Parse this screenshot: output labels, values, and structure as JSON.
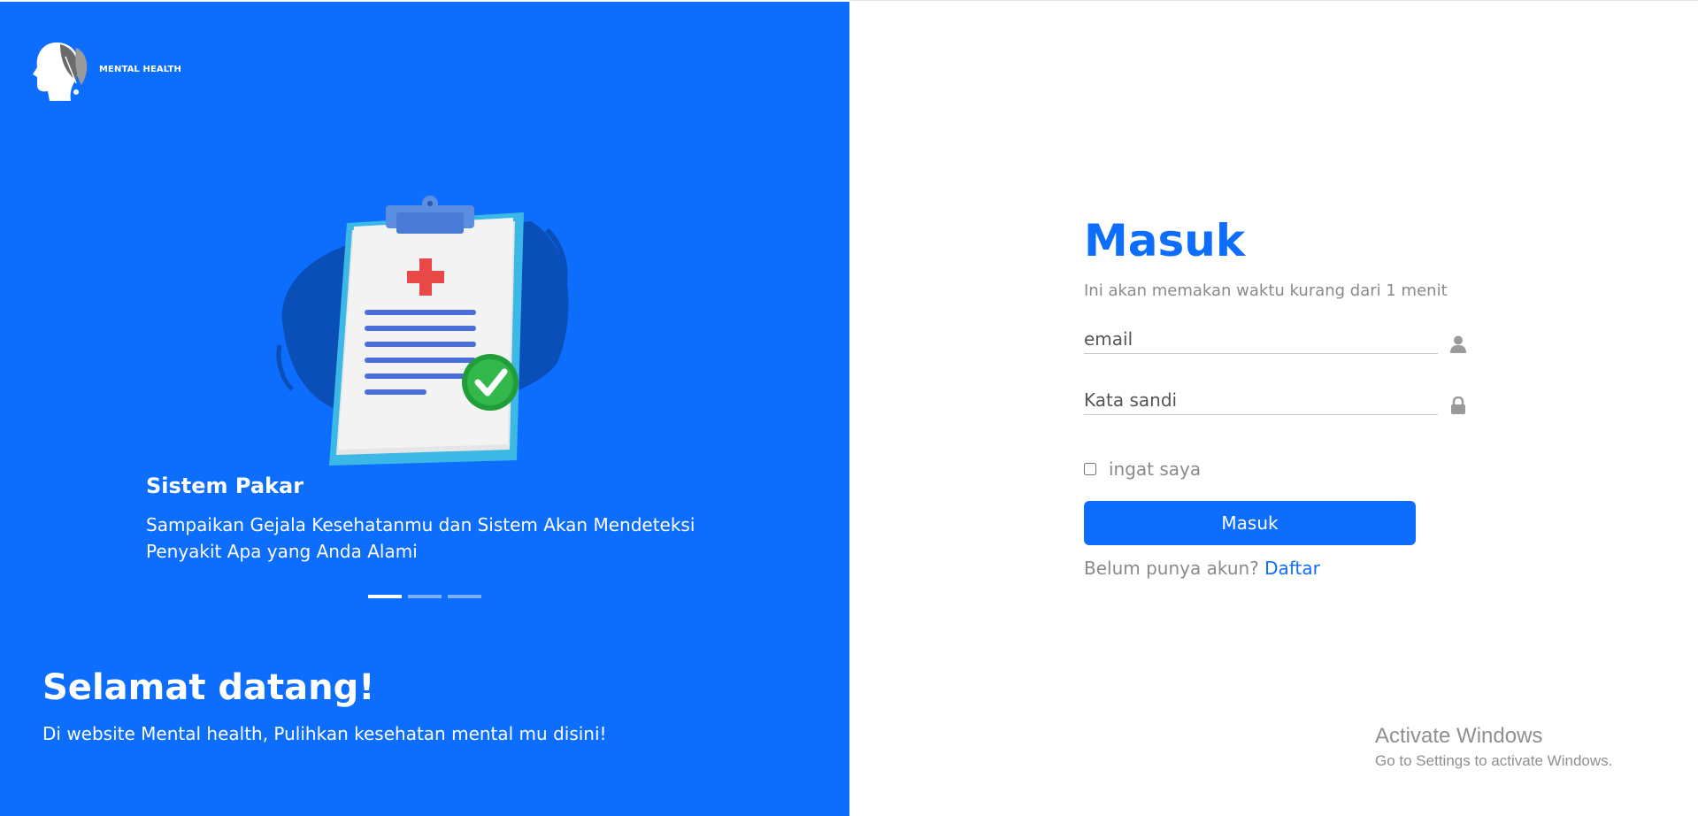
{
  "brand": {
    "name": "MENTAL HEALTH",
    "logo_icon": "head-leaf-icon"
  },
  "carousel": {
    "slides": [
      {
        "title": "Sistem Pakar",
        "description": "Sampaikan Gejala Kesehatanmu dan Sistem Akan Mendeteksi Penyakit Apa yang Anda Alami",
        "image_icon": "medical-clipboard-icon"
      }
    ],
    "active_index": 0,
    "indicator_count": 3
  },
  "welcome": {
    "title": "Selamat datang!",
    "description": "Di website Mental health, Pulihkan kesehatan mental mu disini!"
  },
  "login": {
    "title": "Masuk",
    "subtitle": "Ini akan memakan waktu kurang dari 1 menit",
    "email": {
      "value": "",
      "placeholder": "email",
      "icon": "user-icon"
    },
    "password": {
      "value": "",
      "placeholder": "Kata sandi",
      "icon": "lock-icon"
    },
    "remember_label": "ingat saya",
    "remember_checked": false,
    "submit_label": "Masuk",
    "register_prompt": "Belum punya akun?",
    "register_link": "Daftar"
  },
  "watermark": {
    "title": "Activate Windows",
    "subtitle": "Go to Settings to activate Windows."
  },
  "colors": {
    "primary": "#0d6efd",
    "muted_text": "#8a8a8a",
    "white": "#ffffff"
  }
}
